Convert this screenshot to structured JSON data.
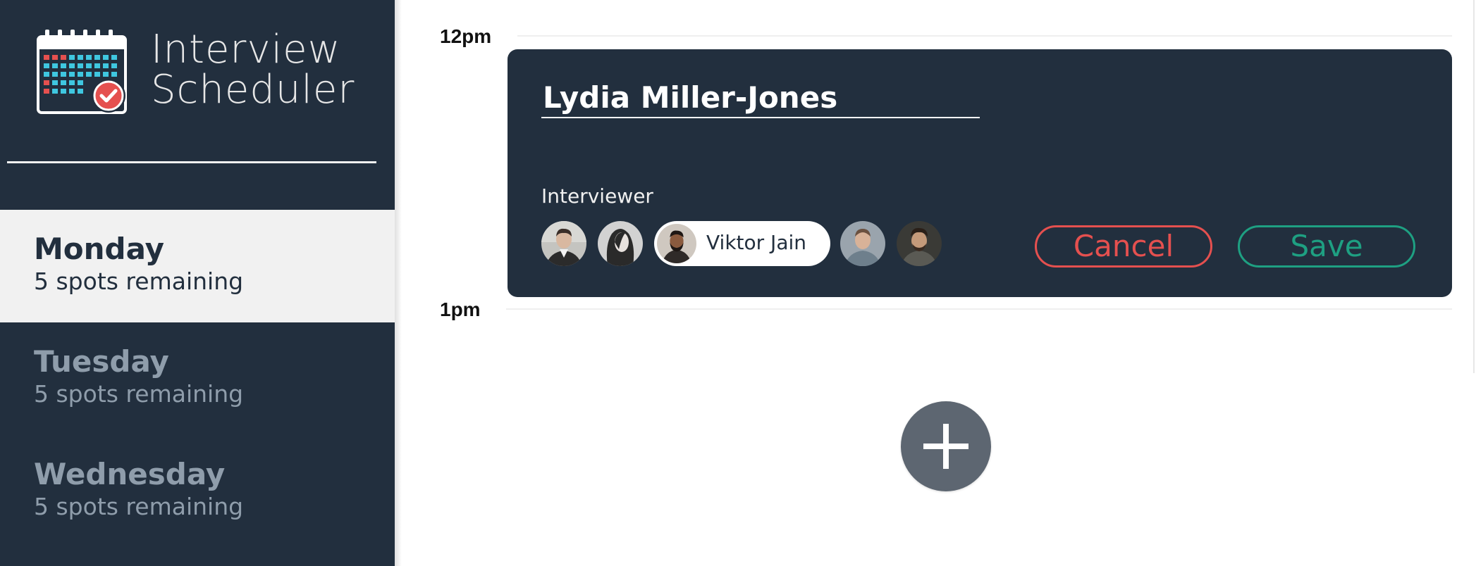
{
  "app": {
    "title_line1": "Interview",
    "title_line2": "Scheduler",
    "logo_icon": "calendar-check-icon"
  },
  "days": [
    {
      "name": "Monday",
      "spots": "5 spots remaining",
      "selected": true
    },
    {
      "name": "Tuesday",
      "spots": "5 spots remaining",
      "selected": false
    },
    {
      "name": "Wednesday",
      "spots": "5 spots remaining",
      "selected": false
    }
  ],
  "schedule": {
    "time_labels": [
      "12pm",
      "1pm"
    ]
  },
  "appointment_form": {
    "student_name": "Lydia Miller-Jones",
    "interviewer_label": "Interviewer",
    "selected_interviewer": "Viktor Jain",
    "cancel_label": "Cancel",
    "save_label": "Save"
  },
  "add_button_icon": "plus-icon",
  "colors": {
    "sidebar_bg": "#222f3e",
    "selected_day_bg": "#f1f1f1",
    "muted_text": "#8f9dab",
    "danger": "#e5504f",
    "success": "#1ea082",
    "add_button_bg": "#5d6671"
  }
}
